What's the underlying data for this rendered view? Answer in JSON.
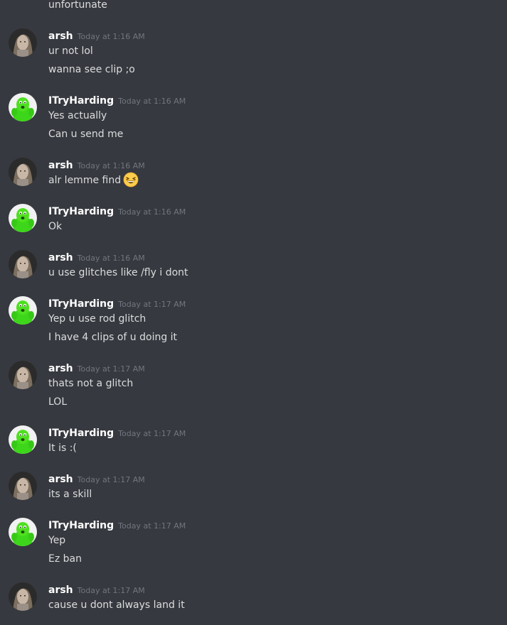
{
  "continuation_text": "unfortunate",
  "messages": [
    {
      "user": "arsh",
      "avatar_icon": "arsh-avatar-icon",
      "time": "Today at 1:16 AM",
      "lines": [
        "ur not lol",
        "wanna see clip ;o"
      ]
    },
    {
      "user": "ITryHarding",
      "avatar_icon": "green-frog-avatar-icon",
      "time": "Today at 1:16 AM",
      "lines": [
        "Yes actually",
        "Can u send me"
      ]
    },
    {
      "user": "arsh",
      "avatar_icon": "arsh-avatar-icon",
      "time": "Today at 1:16 AM",
      "lines": [
        "alr lemme find"
      ],
      "emoji": "grinning-squinting-face-icon"
    },
    {
      "user": "ITryHarding",
      "avatar_icon": "green-frog-avatar-icon",
      "time": "Today at 1:16 AM",
      "lines": [
        "Ok"
      ]
    },
    {
      "user": "arsh",
      "avatar_icon": "arsh-avatar-icon",
      "time": "Today at 1:16 AM",
      "lines": [
        "u use glitches like /fly i dont"
      ]
    },
    {
      "user": "ITryHarding",
      "avatar_icon": "green-frog-avatar-icon",
      "time": "Today at 1:17 AM",
      "lines": [
        "Yep u use rod glitch",
        "I have 4 clips of u doing it"
      ]
    },
    {
      "user": "arsh",
      "avatar_icon": "arsh-avatar-icon",
      "time": "Today at 1:17 AM",
      "lines": [
        "thats not a glitch",
        "LOL"
      ]
    },
    {
      "user": "ITryHarding",
      "avatar_icon": "green-frog-avatar-icon",
      "time": "Today at 1:17 AM",
      "lines": [
        "It is :("
      ]
    },
    {
      "user": "arsh",
      "avatar_icon": "arsh-avatar-icon",
      "time": "Today at 1:17 AM",
      "lines": [
        "its a skill"
      ]
    },
    {
      "user": "ITryHarding",
      "avatar_icon": "green-frog-avatar-icon",
      "time": "Today at 1:17 AM",
      "lines": [
        "Yep",
        "Ez ban"
      ]
    },
    {
      "user": "arsh",
      "avatar_icon": "arsh-avatar-icon",
      "time": "Today at 1:17 AM",
      "lines": [
        "cause u dont always land it"
      ]
    }
  ]
}
